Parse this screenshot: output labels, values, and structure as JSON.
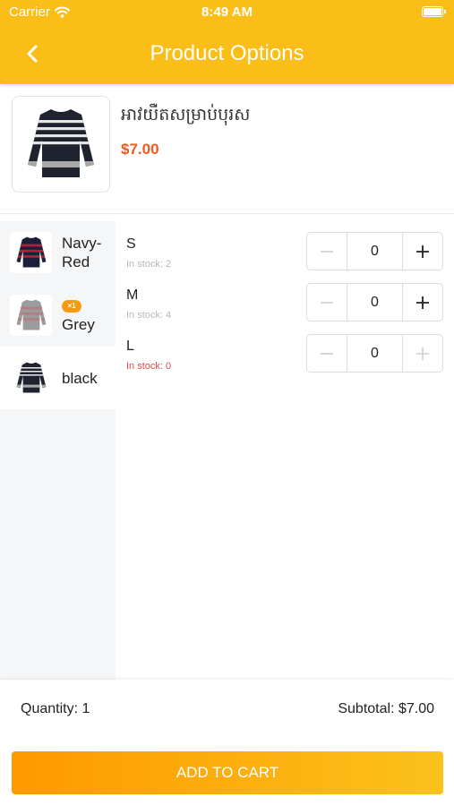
{
  "status_bar": {
    "carrier": "Carrier",
    "time": "8:49 AM"
  },
  "header": {
    "title": "Product Options"
  },
  "product": {
    "name": "អាវយឺតសម្រាប់បុរស",
    "price": "$7.00"
  },
  "colors": [
    {
      "label": "Navy-Red",
      "badge": ""
    },
    {
      "label": "Grey",
      "badge": "×1"
    },
    {
      "label": "black",
      "badge": ""
    }
  ],
  "sizes": [
    {
      "label": "S",
      "stock": "In stock: 2",
      "quantity": "0"
    },
    {
      "label": "M",
      "stock": "In stock: 4",
      "quantity": "0"
    },
    {
      "label": "L",
      "stock": "In stock: 0",
      "quantity": "0"
    }
  ],
  "footer": {
    "quantity_text": "Quantity: 1",
    "subtotal_text": "Subtotal: $7.00",
    "add_to_cart_label": "ADD TO CART"
  },
  "theme": {
    "accent": "#fbbd17",
    "price_color": "#ef5a1c",
    "out_of_stock_color": "#e24b4b",
    "badge_color": "#f69a11"
  }
}
